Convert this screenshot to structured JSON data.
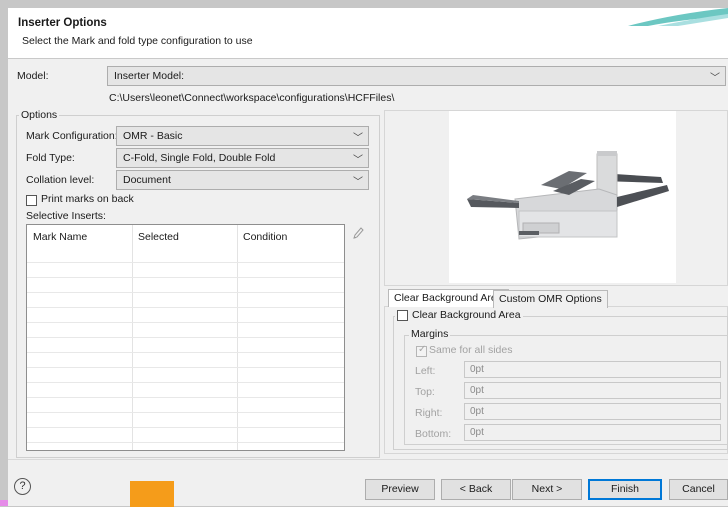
{
  "dialog": {
    "title": "Inserter Options",
    "subtitle": "Select the Mark and fold type configuration to use"
  },
  "model": {
    "label": "Model:",
    "value": "Inserter Model:",
    "path": "C:\\Users\\leonet\\Connect\\workspace\\configurations\\HCFFiles\\"
  },
  "options": {
    "group_title": "Options",
    "mark_configuration": {
      "label": "Mark Configuration:",
      "value": "OMR - Basic"
    },
    "fold_type": {
      "label": "Fold Type:",
      "value": "C-Fold, Single Fold, Double Fold"
    },
    "collation_level": {
      "label": "Collation level:",
      "value": "Document"
    },
    "print_marks_on_back": {
      "label": "Print marks on back",
      "checked": false
    },
    "selective_inserts_label": "Selective Inserts:",
    "table": {
      "columns": [
        "Mark Name",
        "Selected",
        "Condition"
      ],
      "rows": []
    }
  },
  "tabs": [
    {
      "label": "Clear Background Area",
      "active": true
    },
    {
      "label": "Custom OMR Options",
      "active": false
    }
  ],
  "clear_background": {
    "checkbox_label": "Clear Background Area",
    "checked": false,
    "margins_title": "Margins",
    "same_for_all_sides": {
      "label": "Same for all sides",
      "checked": true,
      "disabled": true
    },
    "fields": [
      {
        "label": "Left:",
        "value": "0pt"
      },
      {
        "label": "Top:",
        "value": "0pt"
      },
      {
        "label": "Right:",
        "value": "0pt"
      },
      {
        "label": "Bottom:",
        "value": "0pt"
      }
    ]
  },
  "footer": {
    "help_glyph": "?",
    "preview": "Preview",
    "back": "< Back",
    "next": "Next >",
    "finish": "Finish",
    "cancel": "Cancel"
  },
  "icons": {
    "dropdown": "chevron-down-icon",
    "edit": "pencil-icon",
    "help": "help-icon"
  },
  "colors": {
    "accent_orange": "#f59c1a",
    "default_button_border": "#0078d7"
  }
}
